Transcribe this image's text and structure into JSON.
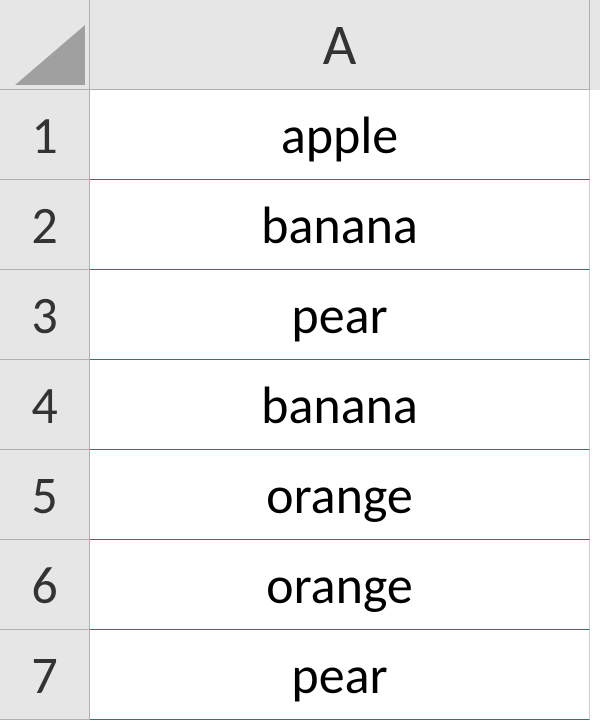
{
  "columns": [
    "A"
  ],
  "rows": [
    {
      "num": "1",
      "value": "apple"
    },
    {
      "num": "2",
      "value": "banana"
    },
    {
      "num": "3",
      "value": "pear"
    },
    {
      "num": "4",
      "value": "banana"
    },
    {
      "num": "5",
      "value": "orange"
    },
    {
      "num": "6",
      "value": "orange"
    },
    {
      "num": "7",
      "value": "pear"
    }
  ]
}
